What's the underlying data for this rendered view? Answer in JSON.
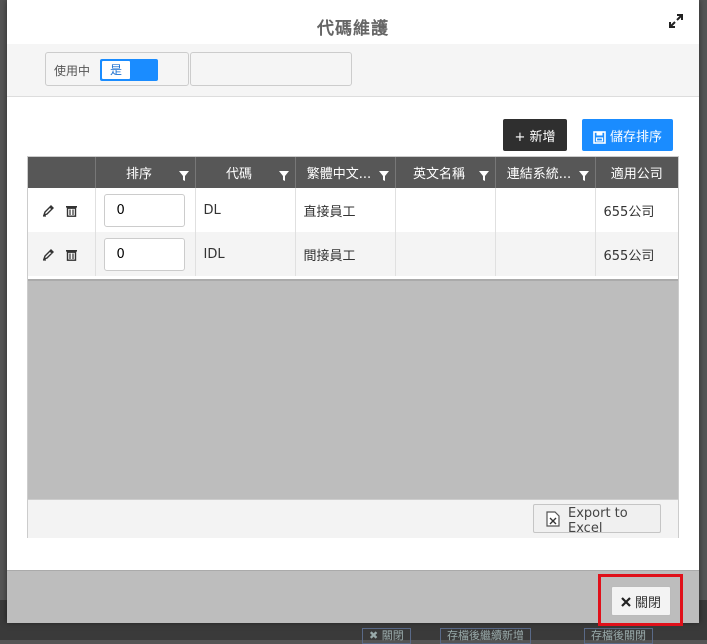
{
  "dialog": {
    "title": "代碼維護"
  },
  "filter": {
    "in_use_label": "使用中",
    "toggle_value": "是"
  },
  "toolbar": {
    "add_label": "+ 新增",
    "save_order_label": "儲存排序"
  },
  "grid": {
    "columns": [
      "",
      "排序",
      "代碼",
      "繁體中文...",
      "英文名稱",
      "連結系統...",
      "適用公司"
    ],
    "rows": [
      {
        "sort": "0",
        "code": "DL",
        "name_zh": "直接員工",
        "name_en": "",
        "link_system": "",
        "company": "655公司"
      },
      {
        "sort": "0",
        "code": "IDL",
        "name_zh": "間接員工",
        "name_en": "",
        "link_system": "",
        "company": "655公司"
      }
    ],
    "export_label": "Export to Excel"
  },
  "footer": {
    "close_label": "關閉"
  },
  "backdrop": {
    "ghost_close": "✖ 關閉",
    "ghost_save_continue": "存檔後繼續新增",
    "ghost_save_close": "存檔後關閉"
  },
  "colors": {
    "primary": "#1a8cff",
    "header_bg": "#575757",
    "highlight": "#e0101a"
  }
}
